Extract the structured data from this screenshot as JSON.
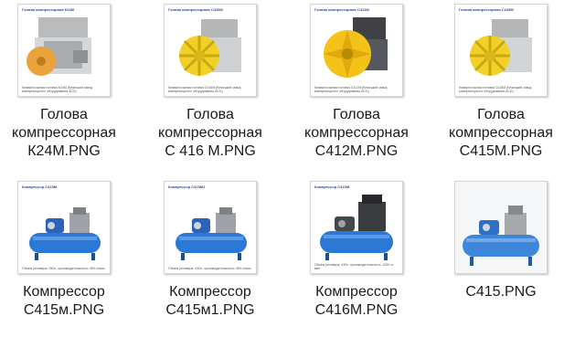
{
  "files": [
    {
      "name_lines": [
        "Голова",
        "компрессорная",
        "К24М.PNG"
      ],
      "thumb_title": "Голова компрессорная К24М",
      "thumb_caption": "Компрессорная головка К24М (Бежецкий завод компрессорного оборудования АСО)",
      "icon": "compressor-head-grey-icon",
      "accent": "#e8a43a"
    },
    {
      "name_lines": [
        "Голова",
        "компрессорная",
        "С 416 М.PNG"
      ],
      "thumb_title": "Голова компрессорная С416М",
      "thumb_caption": "Компрессорная головка С416М (Бежецкий завод компрессорного оборудования АСО)",
      "icon": "compressor-head-yellow-icon",
      "accent": "#f2d027"
    },
    {
      "name_lines": [
        "Голова",
        "компрессорная",
        "С412М.PNG"
      ],
      "thumb_title": "Голова компрессорная С412М",
      "thumb_caption": "Компрессорная головка С412М (Бежецкий завод компрессорного оборудования АСО)",
      "icon": "compressor-head-yellow-fan-icon",
      "accent": "#f5c21a"
    },
    {
      "name_lines": [
        "Голова",
        "компрессорная",
        "С415М.PNG"
      ],
      "thumb_title": "Голова компрессорная С415М",
      "thumb_caption": "Компрессорная головка С415М (Бежецкий завод компрессорного оборудования АСО)",
      "icon": "compressor-head-yellow-icon",
      "accent": "#f2d027"
    },
    {
      "name_lines": [
        "Компрессор",
        "С415м.PNG"
      ],
      "thumb_title": "Компрессор С415М",
      "thumb_caption": "Объём ресивера: 250л; производительность: 690 л/мин",
      "icon": "compressor-blue-tank-icon",
      "accent": "#2b78d6"
    },
    {
      "name_lines": [
        "Компрессор",
        "С415м1.PNG"
      ],
      "thumb_title": "Компрессор С415М1",
      "thumb_caption": "Объём ресивера: 430л; производительность: 690 л/мин",
      "icon": "compressor-blue-tank-icon",
      "accent": "#2b78d6"
    },
    {
      "name_lines": [
        "Компрессор",
        "С416М.PNG"
      ],
      "thumb_title": "Компрессор С416М",
      "thumb_caption": "Объём ресивера: 430л; производительность: 1000 л/мин",
      "icon": "compressor-blue-tank-dark-icon",
      "accent": "#2b78d6"
    },
    {
      "name_lines": [
        "С415.PNG"
      ],
      "thumb_title": "",
      "thumb_caption": "",
      "icon": "compressor-blue-tank-photo-icon",
      "accent": "#3d86d9"
    }
  ]
}
